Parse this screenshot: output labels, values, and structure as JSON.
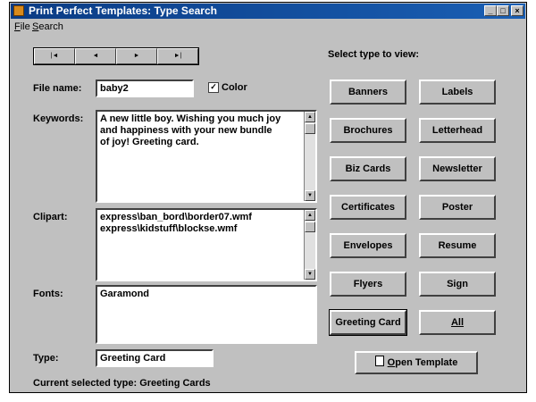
{
  "window": {
    "title": "Print Perfect Templates: Type Search"
  },
  "menu": [
    {
      "label": "File",
      "key": "F",
      "rest": "ile"
    },
    {
      "label": "Search",
      "key": "S",
      "rest": "earch"
    }
  ],
  "nav": {
    "first": "|◄",
    "prev": "◄",
    "next": "►",
    "last": "►|"
  },
  "form": {
    "file_name_label": "File name:",
    "file_name_value": "baby2",
    "color_label": "Color",
    "color_checked": "✓",
    "keywords_label": "Keywords:",
    "keywords_lines": [
      "A new little boy. Wishing you much joy",
      "and happiness with your new bundle",
      "of joy! Greeting card."
    ],
    "clipart_label": "Clipart:",
    "clipart_lines": [
      "express\\ban_bord\\border07.wmf",
      "express\\kidstuff\\blockse.wmf"
    ],
    "fonts_label": "Fonts:",
    "fonts_value": "Garamond",
    "type_label": "Type:",
    "type_value": "Greeting Card"
  },
  "types": {
    "heading": "Select type to view:",
    "buttons": [
      "Banners",
      "Labels",
      "Brochures",
      "Letterhead",
      "Biz Cards",
      "Newsletter",
      "Certificates",
      "Poster",
      "Envelopes",
      "Resume",
      "Flyers",
      "Sign",
      "Greeting Card",
      "All"
    ],
    "active": "Greeting Card"
  },
  "open_template": {
    "key": "O",
    "rest": "pen Template"
  },
  "status": "Current selected type: Greeting Cards"
}
